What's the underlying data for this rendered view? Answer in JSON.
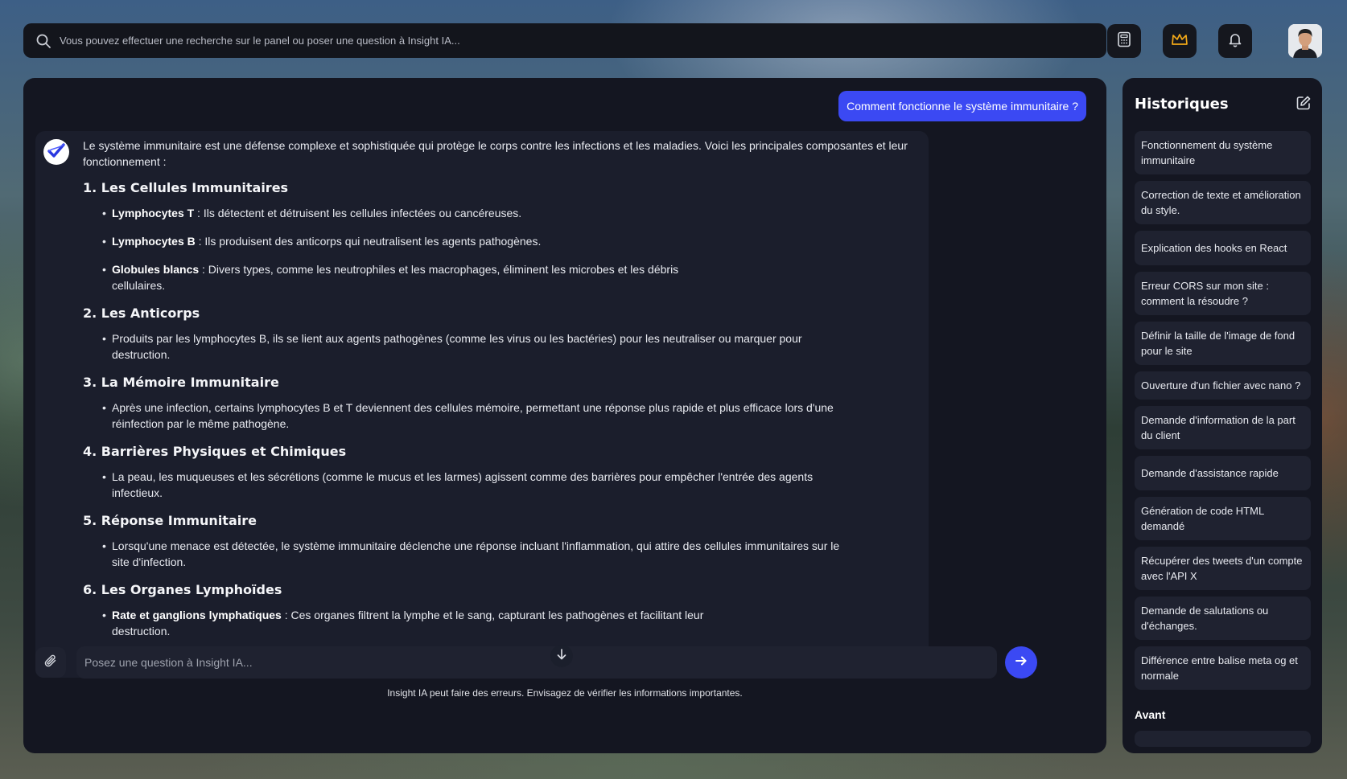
{
  "search": {
    "placeholder": "Vous pouvez effectuer une recherche sur le panel ou poser une question à Insight IA..."
  },
  "top_icons": [
    "calculator-icon",
    "crown-icon",
    "bell-icon"
  ],
  "colors": {
    "accent": "#3b49f3",
    "panel": "#141621",
    "card": "#1b1e2c",
    "input": "#1f2230"
  },
  "chat": {
    "user_message": "Comment fonctionne le système immunitaire ?",
    "bot": {
      "intro": "Le système immunitaire est une défense complexe et sophistiquée qui protège le corps contre les infections et les maladies. Voici les principales composantes et leur fonctionnement :",
      "sections": [
        {
          "title": "1. Les Cellules Immunitaires",
          "bullets": [
            {
              "bold": "Lymphocytes T",
              "text": " : Ils détectent et détruisent les cellules infectées ou cancéreuses."
            },
            {
              "bold": "Lymphocytes B",
              "text": " : Ils produisent des anticorps qui neutralisent les agents pathogènes."
            },
            {
              "bold": "Globules blancs",
              "text": " : Divers types, comme les neutrophiles et les macrophages, éliminent les microbes et les débris cellulaires."
            }
          ]
        },
        {
          "title": "2. Les Anticorps",
          "bullets": [
            {
              "bold": "",
              "text": "Produits par les lymphocytes B, ils se lient aux agents pathogènes (comme les virus ou les bactéries) pour les neutraliser ou marquer pour destruction."
            }
          ]
        },
        {
          "title": "3. La Mémoire Immunitaire",
          "bullets": [
            {
              "bold": "",
              "text": "Après une infection, certains lymphocytes B et T deviennent des cellules mémoire, permettant une réponse plus rapide et plus efficace lors d'une réinfection par le même pathogène."
            }
          ]
        },
        {
          "title": "4. Barrières Physiques et Chimiques",
          "bullets": [
            {
              "bold": "",
              "text": "La peau, les muqueuses et les sécrétions (comme le mucus et les larmes) agissent comme des barrières pour empêcher l'entrée des agents infectieux."
            }
          ]
        },
        {
          "title": "5. Réponse Immunitaire",
          "bullets": [
            {
              "bold": "",
              "text": "Lorsqu'une menace est détectée, le système immunitaire déclenche une réponse incluant l'inflammation, qui attire des cellules immunitaires sur le site d'infection."
            }
          ]
        },
        {
          "title": "6. Les Organes Lymphoïdes",
          "bullets": [
            {
              "bold": "Rate et ganglions lymphatiques",
              "text": " : Ces organes filtrent la lymphe et le sang, capturant les pathogènes et facilitant leur destruction."
            }
          ]
        }
      ]
    },
    "input_placeholder": "Posez une question à Insight IA...",
    "disclaimer": "Insight IA peut faire des erreurs. Envisagez de vérifier les informations importantes."
  },
  "history": {
    "title": "Historiques",
    "items": [
      "Fonctionnement du système immunitaire",
      "Correction de texte et amélioration du style.",
      "Explication des hooks en React",
      "Erreur CORS sur mon site : comment la résoudre ?",
      "Définir la taille de l'image de fond pour le site",
      "Ouverture d'un fichier avec nano ?",
      "Demande d'information de la part du client",
      "Demande d'assistance rapide",
      "Génération de code HTML demandé",
      "Récupérer des tweets d'un compte avec l'API X",
      "Demande de salutations ou d'échanges.",
      "Différence entre balise meta og et normale"
    ],
    "section_before": "Avant"
  }
}
